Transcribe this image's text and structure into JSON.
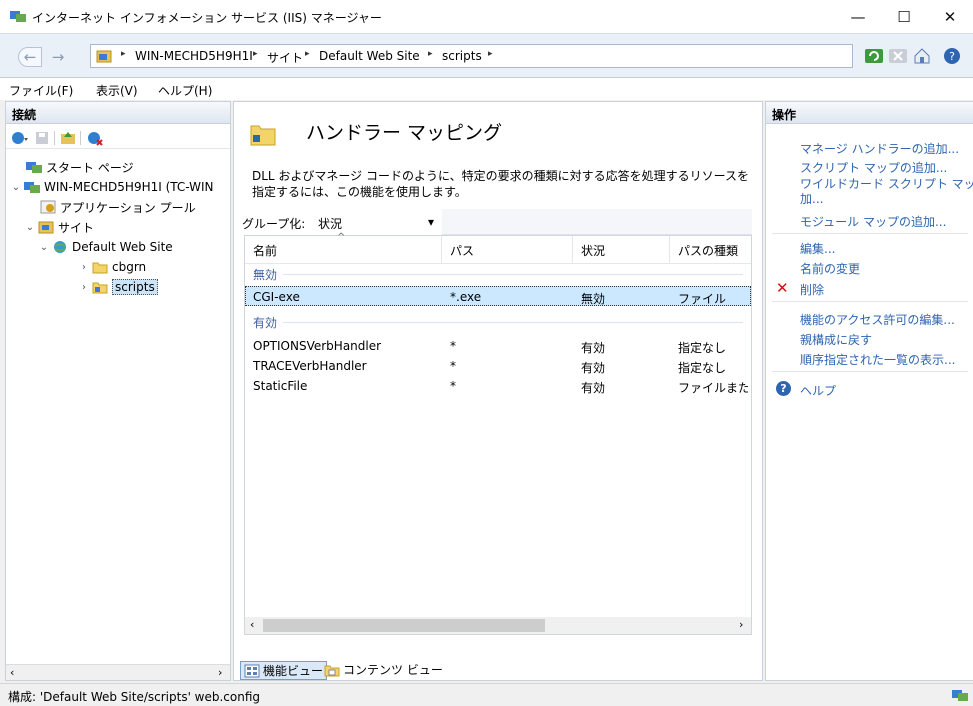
{
  "window": {
    "title": "インターネット インフォメーション サービス (IIS) マネージャー",
    "minimize_label": "—",
    "maximize_label": "☐",
    "close_label": "✕"
  },
  "address": {
    "back_label": "←",
    "forward_label": "→",
    "breadcrumbs": [
      "WIN-MECHD5H9H1I",
      "サイト",
      "Default Web Site",
      "scripts"
    ],
    "separator": "▸"
  },
  "menu": {
    "items": [
      "ファイル(F)",
      "表示(V)",
      "ヘルプ(H)"
    ]
  },
  "connections": {
    "header": "接続",
    "tree": [
      {
        "label": "スタート ページ"
      },
      {
        "label": "WIN-MECHD5H9H1I (TC-WIN"
      },
      {
        "label": "アプリケーション プール"
      },
      {
        "label": "サイト"
      },
      {
        "label": "Default Web Site"
      },
      {
        "label": "cbgrn"
      },
      {
        "label": "scripts"
      }
    ],
    "chev_expanded": "⌄",
    "chev_collapsed": "›",
    "scroll_left": "‹",
    "scroll_right": "›"
  },
  "feature": {
    "title": "ハンドラー マッピング",
    "description": "DLL およびマネージ コードのように、特定の要求の種類に対する応答を処理するリソースを指定するには、この機能を使用します。",
    "groupby_label": "グループ化:",
    "groupby_value": "状況",
    "dropdown_arrow": "▾",
    "sort_arrow": "^"
  },
  "grid": {
    "columns": [
      "名前",
      "パス",
      "状況",
      "パスの種類"
    ],
    "groups": [
      {
        "label": "無効",
        "rows": [
          {
            "name": "CGI-exe",
            "path": "*.exe",
            "state": "無効",
            "type": "ファイル"
          }
        ]
      },
      {
        "label": "有効",
        "rows": [
          {
            "name": "OPTIONSVerbHandler",
            "path": "*",
            "state": "有効",
            "type": "指定なし"
          },
          {
            "name": "TRACEVerbHandler",
            "path": "*",
            "state": "有効",
            "type": "指定なし"
          },
          {
            "name": "StaticFile",
            "path": "*",
            "state": "有効",
            "type": "ファイルまた"
          }
        ]
      }
    ],
    "scroll_left": "‹",
    "scroll_right": "›"
  },
  "view_tabs": {
    "features": "機能ビュー",
    "content": "コンテンツ ビュー"
  },
  "actions": {
    "header": "操作",
    "items": [
      "マネージ ハンドラーの追加...",
      "スクリプト マップの追加...",
      "ワイルドカード スクリプト マップの追加...",
      "モジュール マップの追加...",
      "編集...",
      "名前の変更",
      "削除",
      "機能のアクセス許可の編集...",
      "親構成に戻す",
      "順序指定された一覧の表示...",
      "ヘルプ"
    ],
    "wildcard_line1": "ワイルドカード スクリプト マップの追",
    "wildcard_line2": "加...",
    "delete_mark": "✕",
    "help_mark": "?"
  },
  "status": {
    "text": "構成: 'Default Web Site/scripts' web.config"
  }
}
